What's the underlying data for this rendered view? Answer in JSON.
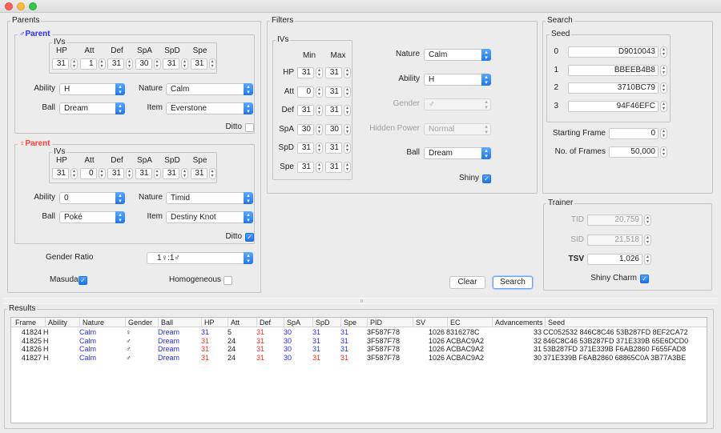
{
  "window": {
    "title": ""
  },
  "parents": {
    "title": "Parents",
    "male": {
      "title": "♂Parent",
      "ivs_title": "IVs",
      "iv_labels": [
        "HP",
        "Att",
        "Def",
        "SpA",
        "SpD",
        "Spe"
      ],
      "ivs": [
        "31",
        "1",
        "31",
        "30",
        "31",
        "31"
      ],
      "ability_label": "Ability",
      "ability": "H",
      "nature_label": "Nature",
      "nature": "Calm",
      "ball_label": "Ball",
      "ball": "Dream",
      "item_label": "Item",
      "item": "Everstone",
      "ditto_label": "Ditto",
      "ditto": false
    },
    "female": {
      "title": "♀Parent",
      "ivs_title": "IVs",
      "iv_labels": [
        "HP",
        "Att",
        "Def",
        "SpA",
        "SpD",
        "Spe"
      ],
      "ivs": [
        "31",
        "0",
        "31",
        "31",
        "31",
        "31"
      ],
      "ability_label": "Ability",
      "ability": "0",
      "nature_label": "Nature",
      "nature": "Timid",
      "ball_label": "Ball",
      "ball": "Poké",
      "item_label": "Item",
      "item": "Destiny Knot",
      "ditto_label": "Ditto",
      "ditto": true
    },
    "gender_ratio_label": "Gender Ratio",
    "gender_ratio": "1♀:1♂",
    "masuda_label": "Masuda",
    "masuda": true,
    "homogeneous_label": "Homogeneous",
    "homogeneous": false
  },
  "filters": {
    "title": "Filters",
    "ivs_title": "IVs",
    "min_label": "Min",
    "max_label": "Max",
    "rows": [
      {
        "label": "HP",
        "min": "31",
        "max": "31"
      },
      {
        "label": "Att",
        "min": "0",
        "max": "31"
      },
      {
        "label": "Def",
        "min": "31",
        "max": "31"
      },
      {
        "label": "SpA",
        "min": "30",
        "max": "30"
      },
      {
        "label": "SpD",
        "min": "31",
        "max": "31"
      },
      {
        "label": "Spe",
        "min": "31",
        "max": "31"
      }
    ],
    "nature_label": "Nature",
    "nature": "Calm",
    "ability_label": "Ability",
    "ability": "H",
    "gender_label": "Gender",
    "gender": "♂",
    "hidden_power_label": "Hidden Power",
    "hidden_power": "Normal",
    "ball_label": "Ball",
    "ball": "Dream",
    "shiny_label": "Shiny",
    "shiny": true
  },
  "search": {
    "title": "Search",
    "seed_title": "Seed",
    "seeds": [
      {
        "label": "0",
        "value": "D9010043"
      },
      {
        "label": "1",
        "value": "BBEEB4B8"
      },
      {
        "label": "2",
        "value": "3710BC79"
      },
      {
        "label": "3",
        "value": "94F46EFC"
      }
    ],
    "starting_frame_label": "Starting Frame",
    "starting_frame": "0",
    "num_frames_label": "No. of Frames",
    "num_frames": "50,000"
  },
  "trainer": {
    "title": "Trainer",
    "tid_label": "TID",
    "tid": "20,759",
    "sid_label": "SID",
    "sid": "21,518",
    "tsv_label": "TSV",
    "tsv": "1,026",
    "shiny_charm_label": "Shiny Charm",
    "shiny_charm": true
  },
  "buttons": {
    "clear": "Clear",
    "search": "Search"
  },
  "results": {
    "title": "Results",
    "columns": [
      "Frame",
      "Ability",
      "Nature",
      "Gender",
      "Ball",
      "HP",
      "Att",
      "Def",
      "SpA",
      "SpD",
      "Spe",
      "PID",
      "SV",
      "EC",
      "Advancements",
      "Seed"
    ],
    "rows": [
      {
        "frame": "41824",
        "ability": "H",
        "nature": "Calm",
        "gender": "♀",
        "ball": "Dream",
        "hp": "31",
        "att": "5",
        "def": "31",
        "spa": "30",
        "spd": "31",
        "spe": "31",
        "hp_c": "blue",
        "att_c": "",
        "def_c": "redc",
        "spa_c": "blue",
        "spd_c": "blue",
        "spe_c": "blue",
        "pid": "3F587F78",
        "sv": "1026",
        "ec": "8316278C",
        "adv": "33",
        "seed": "CC052532 846C8C46 53B287FD 8EF2CA72"
      },
      {
        "frame": "41825",
        "ability": "H",
        "nature": "Calm",
        "gender": "♂",
        "ball": "Dream",
        "hp": "31",
        "att": "24",
        "def": "31",
        "spa": "30",
        "spd": "31",
        "spe": "31",
        "hp_c": "redc",
        "att_c": "",
        "def_c": "redc",
        "spa_c": "blue",
        "spd_c": "blue",
        "spe_c": "blue",
        "pid": "3F587F78",
        "sv": "1026",
        "ec": "ACBAC9A2",
        "adv": "32",
        "seed": "846C8C46 53B287FD 371E339B 65E6DCD0"
      },
      {
        "frame": "41826",
        "ability": "H",
        "nature": "Calm",
        "gender": "♂",
        "ball": "Dream",
        "hp": "31",
        "att": "24",
        "def": "31",
        "spa": "30",
        "spd": "31",
        "spe": "31",
        "hp_c": "redc",
        "att_c": "",
        "def_c": "redc",
        "spa_c": "blue",
        "spd_c": "blue",
        "spe_c": "blue",
        "pid": "3F587F78",
        "sv": "1026",
        "ec": "ACBAC9A2",
        "adv": "31",
        "seed": "53B287FD 371E339B F6AB2860 F655FAD8"
      },
      {
        "frame": "41827",
        "ability": "H",
        "nature": "Calm",
        "gender": "♂",
        "ball": "Dream",
        "hp": "31",
        "att": "24",
        "def": "31",
        "spa": "30",
        "spd": "31",
        "spe": "31",
        "hp_c": "redc",
        "att_c": "",
        "def_c": "redc",
        "spa_c": "blue",
        "spd_c": "redc",
        "spe_c": "redc",
        "pid": "3F587F78",
        "sv": "1026",
        "ec": "ACBAC9A2",
        "adv": "30",
        "seed": "371E339B F6AB2860 68865C0A 3B77A3BE"
      }
    ]
  },
  "colors": {
    "male": "#2b2bff",
    "female": "#ff3b3b",
    "iv_inherited_blue": "#2a2aff",
    "iv_inherited_red": "#ff2a2a",
    "accent": "#1f75f0"
  }
}
